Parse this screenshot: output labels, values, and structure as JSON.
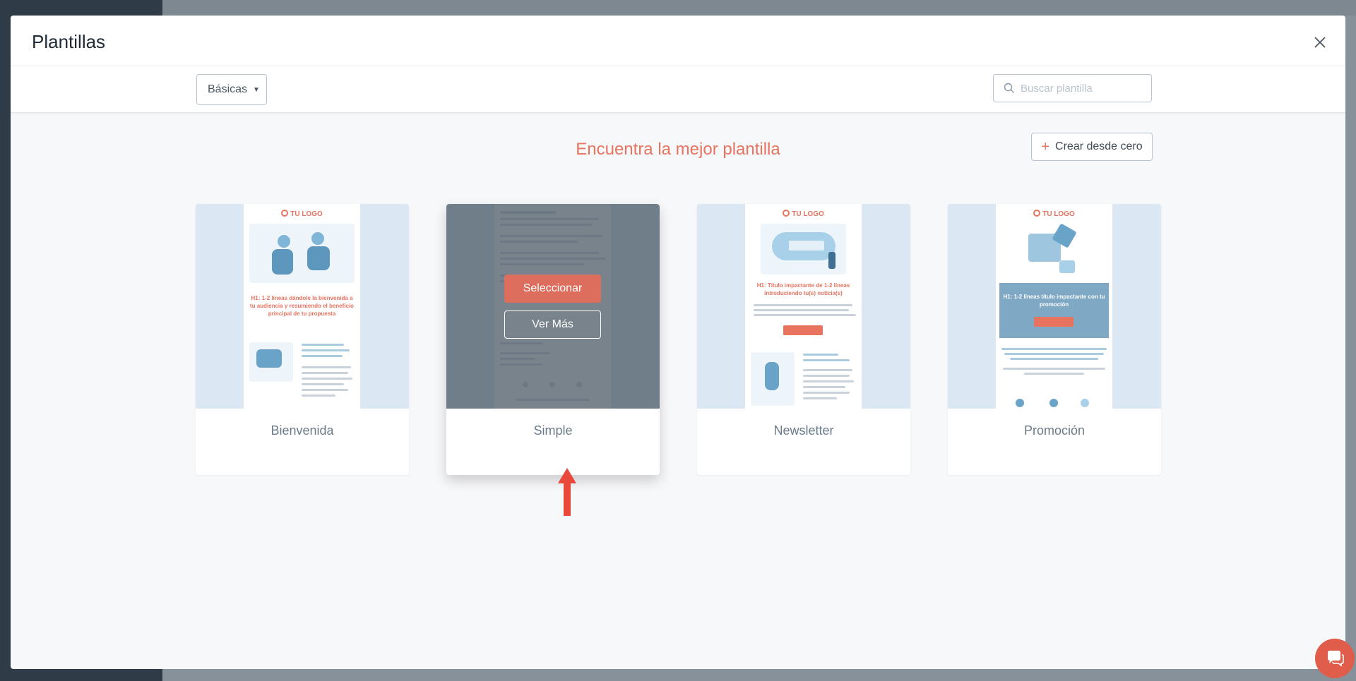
{
  "modal": {
    "title": "Plantillas"
  },
  "toolbar": {
    "category_label": "Básicas",
    "search_placeholder": "Buscar plantilla"
  },
  "main": {
    "headline": "Encuentra la mejor plantilla",
    "create_label": "Crear desde cero"
  },
  "templates": [
    {
      "name": "Bienvenida",
      "logo": "TU LOGO",
      "heading": "H1: 1-2 líneas dándole la bienvenida a tu audiencia y resumiendo el beneficio principal de tu propuesta"
    },
    {
      "name": "Simple",
      "hover_actions": {
        "select": "Seleccionar",
        "more": "Ver Más"
      }
    },
    {
      "name": "Newsletter",
      "logo": "TU LOGO",
      "heading": "H1: Título impactante de 1-2 líneas introduciendo tu(s) noticia(s)"
    },
    {
      "name": "Promoción",
      "logo": "TU LOGO",
      "heading": "H1: 1-2 líneas título impactante con tu promoción"
    }
  ],
  "colors": {
    "accent": "#e8735f",
    "chat": "#e05d4c",
    "arrow": "#e8493a"
  },
  "icons": {
    "close": "close-icon",
    "search": "search-icon",
    "plus": "plus-icon",
    "chat": "chat-icon"
  }
}
